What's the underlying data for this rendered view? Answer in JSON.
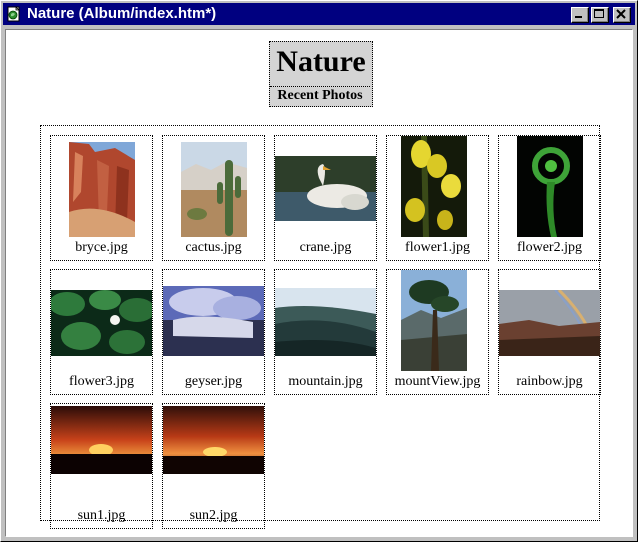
{
  "window": {
    "title": "Nature (Album/index.htm*)"
  },
  "icons": {
    "app": "html-document-icon",
    "minimize": "minimize-icon",
    "maximize": "maximize-icon",
    "close": "close-icon"
  },
  "page": {
    "title": "Nature",
    "subtitle": "Recent Photos"
  },
  "photos": [
    "bryce.jpg",
    "cactus.jpg",
    "crane.jpg",
    "flower1.jpg",
    "flower2.jpg",
    "flower3.jpg",
    "geyser.jpg",
    "mountain.jpg",
    "mountView.jpg",
    "rainbow.jpg",
    "sun1.jpg",
    "sun2.jpg"
  ],
  "colors": {
    "titlebar": "#000080",
    "background": "#ffffff",
    "chrome": "#c0c0c0"
  }
}
